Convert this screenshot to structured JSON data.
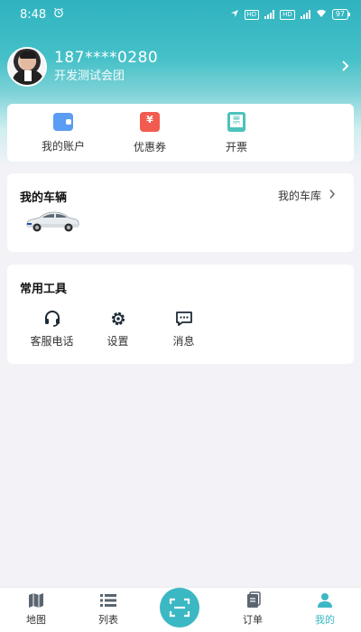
{
  "status_bar": {
    "time": "8:48",
    "battery": "97",
    "icons": [
      "alarm-icon",
      "location-icon",
      "hd-icon",
      "signal-icon",
      "wifi-icon",
      "battery-icon"
    ]
  },
  "profile": {
    "phone": "187****0280",
    "organization": "开发测试会团"
  },
  "quick_actions": [
    {
      "label": "我的账户",
      "icon": "wallet-icon"
    },
    {
      "label": "优惠券",
      "icon": "coupon-icon"
    },
    {
      "label": "开票",
      "icon": "invoice-icon"
    }
  ],
  "vehicle": {
    "title": "我的车辆",
    "garage_link": "我的车库"
  },
  "tools": {
    "title": "常用工具",
    "items": [
      {
        "label": "客服电话",
        "icon": "headset-icon"
      },
      {
        "label": "设置",
        "icon": "gear-icon"
      },
      {
        "label": "消息",
        "icon": "message-icon"
      }
    ]
  },
  "tabbar": {
    "items": [
      {
        "label": "地图",
        "icon": "map-icon"
      },
      {
        "label": "列表",
        "icon": "list-icon"
      },
      {
        "label": "",
        "icon": "scan-icon"
      },
      {
        "label": "订单",
        "icon": "order-icon"
      },
      {
        "label": "我的",
        "icon": "user-icon"
      }
    ],
    "active": "我的"
  },
  "colors": {
    "accent": "#3bb8c3",
    "header_top": "#2fb3c0",
    "background": "#f2f2f7"
  }
}
